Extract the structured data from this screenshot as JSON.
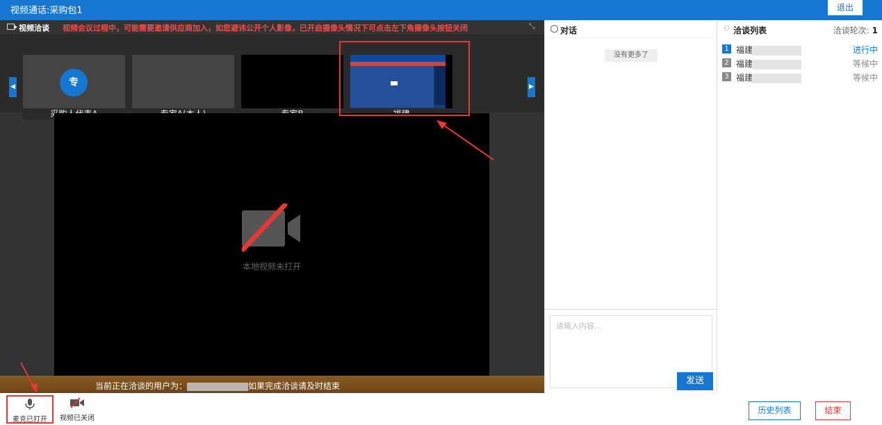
{
  "window": {
    "title": "视频通话:采购包1",
    "exit_label": "退出"
  },
  "video_panel": {
    "label": "视频洽谈",
    "warning": "视频会议过程中，可能需要邀请供应商加入，如您避讳公开个人影像，已开启摄像头情况下可点击左下角摄像头按钮关闭",
    "thumbnails": [
      {
        "caption": "采购人代表A",
        "avatar_text": "专"
      },
      {
        "caption": "专家A(本人)"
      },
      {
        "caption": "专家B"
      },
      {
        "caption": "福建"
      }
    ],
    "main_video_status": "本地视频未打开",
    "status_prefix": "当前正在洽谈的用户为：",
    "status_suffix": "如果完成洽谈请及时结束"
  },
  "chat": {
    "title": "对话",
    "no_more": "没有更多了",
    "input_placeholder": "请输入内容...",
    "send_label": "发送"
  },
  "negotiation_list": {
    "title": "洽谈列表",
    "rounds_label": "洽谈轮次:",
    "rounds_value": "1",
    "items": [
      {
        "num": "1",
        "name": "福建",
        "status": "进行中",
        "active": true
      },
      {
        "num": "2",
        "name": "福建",
        "status": "等候中",
        "active": false
      },
      {
        "num": "3",
        "name": "福建",
        "status": "等候中",
        "active": false
      }
    ]
  },
  "toolbar": {
    "mic_label": "麦克已打开",
    "camera_label": "视频已关闭",
    "history_label": "历史列表",
    "end_label": "结束"
  },
  "colors": {
    "primary": "#1677d2",
    "danger": "#e53935",
    "warning_text": "#f24b4b"
  }
}
